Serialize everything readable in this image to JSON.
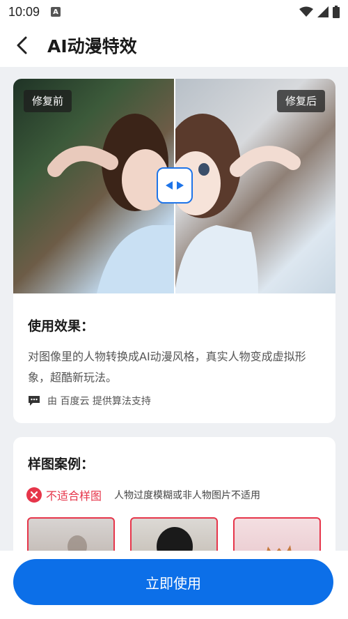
{
  "status_bar": {
    "time": "10:09",
    "notification_letter": "A"
  },
  "header": {
    "title": "AI动漫特效"
  },
  "compare": {
    "before_label": "修复前",
    "after_label": "修复后"
  },
  "usage": {
    "title": "使用效果：",
    "description": "对图像里的人物转换成AI动漫风格，真实人物变成虚拟形象，超酷新玩法。",
    "provider": "由 百度云 提供算法支持"
  },
  "samples": {
    "title": "样图案例：",
    "unsuitable_label": "不适合样图",
    "unsuitable_note": "人物过度模糊或非人物图片不适用"
  },
  "primary_action": {
    "label": "立即使用"
  },
  "colors": {
    "accent": "#0c6fe8",
    "error": "#e6354a"
  }
}
